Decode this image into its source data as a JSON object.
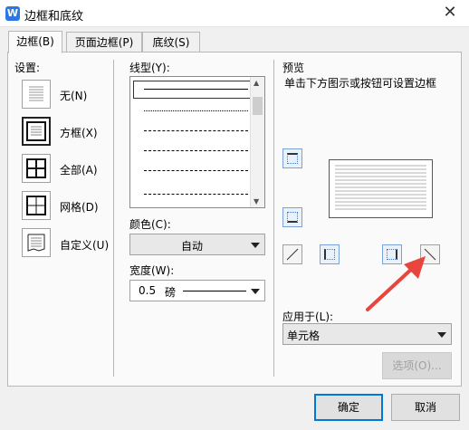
{
  "window": {
    "title": "边框和底纹",
    "app_icon": "W",
    "close": "✕"
  },
  "tabs": [
    {
      "label": "边框(B)",
      "active": true
    },
    {
      "label": "页面边框(P)",
      "active": false
    },
    {
      "label": "底纹(S)",
      "active": false
    }
  ],
  "settings": {
    "heading": "设置:",
    "items": [
      {
        "label": "无(N)",
        "icon": "none-border-icon"
      },
      {
        "label": "方框(X)",
        "icon": "box-border-icon",
        "selected": true
      },
      {
        "label": "全部(A)",
        "icon": "all-borders-icon"
      },
      {
        "label": "网格(D)",
        "icon": "grid-border-icon"
      },
      {
        "label": "自定义(U)",
        "icon": "custom-border-icon"
      }
    ]
  },
  "style": {
    "linetype_label": "线型(Y):",
    "color_label": "颜色(C):",
    "color_value": "自动",
    "width_label": "宽度(W):",
    "width_value": "0.5",
    "width_unit": "磅"
  },
  "preview": {
    "heading": "预览",
    "hint": "单击下方图示或按钮可设置边框",
    "apply_label": "应用于(L):",
    "apply_value": "单元格",
    "options_button": "选项(O)..."
  },
  "buttons": {
    "ok": "确定",
    "cancel": "取消"
  },
  "colors": {
    "accent": "#0078d7",
    "arrow": "#e8453c",
    "preview_button_border": "#7aa2d8"
  }
}
